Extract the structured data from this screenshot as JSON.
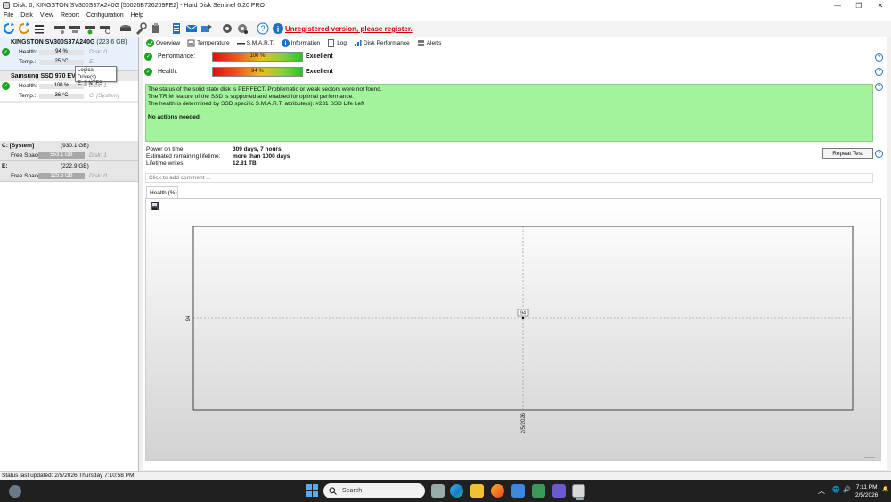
{
  "window": {
    "title": "Disk: 0, KINGSTON SV300S37A240G [50026B726209FE2] - Hard Disk Sentinel 6.20 PRO",
    "controls": [
      "—",
      "❐",
      "✕"
    ]
  },
  "menu": [
    "File",
    "Disk",
    "View",
    "Report",
    "Configuration",
    "Help"
  ],
  "toolbar": {
    "unregistered": "Unregistered version, please register."
  },
  "disks": [
    {
      "name": "KINGSTON SV300S37A240G",
      "size": "(223.6 GB)",
      "health_label": "Health:",
      "health": "94 %",
      "health_value": 94,
      "health_disk": "Disk: 0",
      "temp_label": "Temp.:",
      "temp": "25 °C",
      "temp_value": 25,
      "temp_extra": "E:"
    },
    {
      "name": "Samsung SSD 970 EVO Pl",
      "size": "",
      "health_label": "Health:",
      "health": "100 %",
      "health_value": 100,
      "health_disk": "Disk: 1",
      "temp_label": "Temp.:",
      "temp": "36 °C",
      "temp_value": 36,
      "temp_extra": "C: [System]"
    }
  ],
  "tooltip": {
    "line1": "Logical Drive(s)",
    "line2": "E: [] NTFS"
  },
  "volumes": [
    {
      "name": "C: [System]",
      "size": "(930.1 GB)",
      "free_label": "Free Space",
      "free": "553.1 GB",
      "free_percent": 59,
      "disk": "Disk: 1"
    },
    {
      "name": "E:",
      "size": "(222.9 GB)",
      "free_label": "Free Space",
      "free": "125.5 GB",
      "free_percent": 56,
      "disk": "Disk: 0"
    }
  ],
  "tabs": [
    "Overview",
    "Temperature",
    "S.M.A.R.T.",
    "Information",
    "Log",
    "Disk Performance",
    "Alerts"
  ],
  "overview": {
    "performance_label": "Performance:",
    "performance": "100 %",
    "performance_value": 100,
    "performance_rating": "Excellent",
    "health_label": "Health:",
    "health": "94 %",
    "health_value": 94,
    "health_rating": "Excellent",
    "status_lines": [
      "The status of the solid state disk is PERFECT. Problematic or weak sectors were not found.",
      "The TRIM feature of the SSD is supported and enabled for optimal performance.",
      "The health is determined by SSD specific S.M.A.R.T. attribute(s):  #231 SSD Life Left"
    ],
    "status_action": "No actions needed.",
    "power_on_label": "Power on time:",
    "power_on": "309 days, 7 hours",
    "remaining_label": "Estimated remaining lifetime:",
    "remaining": "more than 1000 days",
    "writes_label": "Lifetime writes:",
    "writes": "12.81 TB",
    "repeat_test": "Repeat Test",
    "comment_placeholder": "Click to add comment ..."
  },
  "chart_tab": "Health (%)",
  "chart_data": {
    "type": "line",
    "x": [
      "2/5/2026"
    ],
    "values": [
      94
    ],
    "x_tick_labels": [
      "2/5/2026"
    ],
    "y_tick_labels": [
      "94"
    ],
    "point_labels": [
      "94"
    ],
    "grid": true
  },
  "statusbar": "Status last updated: 2/5/2026 Thursday 7:10:58 PM",
  "taskbar": {
    "search": "Search",
    "time": "7:11 PM",
    "date": "2/5/2026"
  }
}
